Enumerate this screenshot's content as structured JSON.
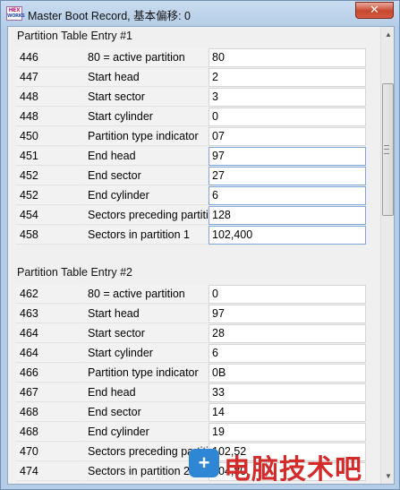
{
  "window": {
    "title": "Master Boot Record, 基本偏移: 0",
    "close_label": "✕",
    "icon": {
      "name": "hex-app-icon",
      "text_top": "HEX",
      "text_bottom": "WORKS"
    }
  },
  "sections": [
    {
      "title": "Partition Table Entry #1",
      "rows": [
        {
          "offset": "446",
          "name": "80 = active partition",
          "value": "80",
          "focus": false
        },
        {
          "offset": "447",
          "name": "Start head",
          "value": "2",
          "focus": false
        },
        {
          "offset": "448",
          "name": "Start sector",
          "value": "3",
          "focus": false
        },
        {
          "offset": "448",
          "name": "Start cylinder",
          "value": "0",
          "focus": false
        },
        {
          "offset": "450",
          "name": "Partition type indicator",
          "value": "07",
          "focus": false
        },
        {
          "offset": "451",
          "name": "End head",
          "value": "97",
          "focus": true
        },
        {
          "offset": "452",
          "name": "End sector",
          "value": "27",
          "focus": true
        },
        {
          "offset": "452",
          "name": "End cylinder",
          "value": "6",
          "focus": true
        },
        {
          "offset": "454",
          "name": "Sectors preceding partition",
          "value": "128",
          "focus": true
        },
        {
          "offset": "458",
          "name": "Sectors in partition 1",
          "value": "102,400",
          "focus": true
        }
      ]
    },
    {
      "title": "Partition Table Entry #2",
      "rows": [
        {
          "offset": "462",
          "name": "80 = active partition",
          "value": "0",
          "focus": false
        },
        {
          "offset": "463",
          "name": "Start head",
          "value": "97",
          "focus": false
        },
        {
          "offset": "464",
          "name": "Start sector",
          "value": "28",
          "focus": false
        },
        {
          "offset": "464",
          "name": "Start cylinder",
          "value": "6",
          "focus": false
        },
        {
          "offset": "466",
          "name": "Partition type indicator",
          "value": "0B",
          "focus": false
        },
        {
          "offset": "467",
          "name": "End head",
          "value": "33",
          "focus": false
        },
        {
          "offset": "468",
          "name": "End sector",
          "value": "14",
          "focus": false
        },
        {
          "offset": "468",
          "name": "End cylinder",
          "value": "19",
          "focus": false
        },
        {
          "offset": "470",
          "name": "Sectors preceding partition",
          "value": "102,52",
          "focus": false
        },
        {
          "offset": "474",
          "name": "Sectors in partition 2",
          "value": "204,80",
          "focus": false
        }
      ]
    }
  ],
  "scrollbar": {
    "up_icon": "▲",
    "down_icon": "▼",
    "position": 0.0
  },
  "watermark": {
    "icon": "+",
    "text": "电脑技术吧"
  }
}
